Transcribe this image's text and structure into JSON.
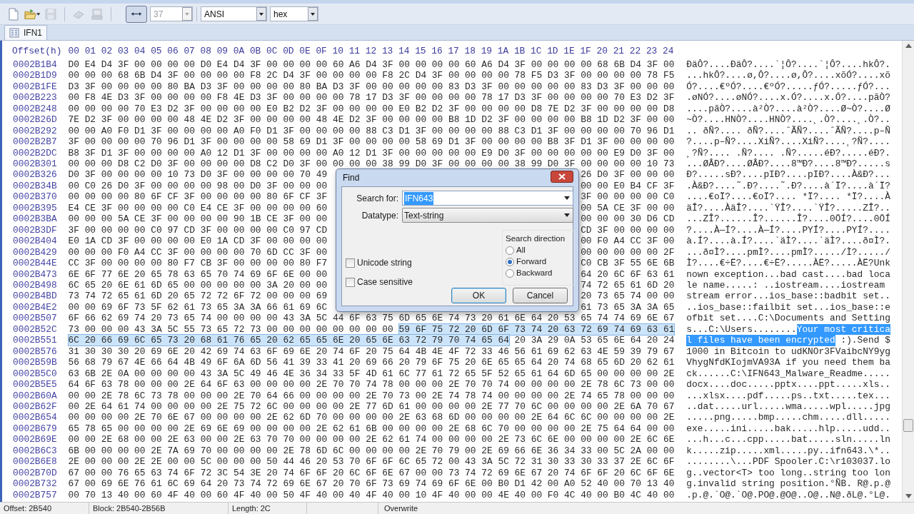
{
  "toolbar": {
    "icon_buttons": [
      {
        "kind": "new",
        "disabled": false
      },
      {
        "kind": "open",
        "disabled": false
      },
      {
        "kind": "save",
        "disabled": true
      },
      {
        "kind": "chip",
        "disabled": true
      },
      {
        "kind": "computer",
        "disabled": true
      },
      {
        "kind": "fit",
        "disabled": false
      }
    ],
    "bytes_per_row": {
      "value": "37",
      "disabled": true
    },
    "charset": {
      "value": "ANSI"
    },
    "view_mode": {
      "value": "hex"
    }
  },
  "tabs": [
    {
      "label": "IFN1",
      "selected": true
    }
  ],
  "editor": {
    "offset_header": "Offset(h)",
    "column_headers": [
      "00",
      "01",
      "02",
      "03",
      "04",
      "05",
      "06",
      "07",
      "08",
      "09",
      "0A",
      "0B",
      "0C",
      "0D",
      "0E",
      "0F",
      "10",
      "11",
      "12",
      "13",
      "14",
      "15",
      "16",
      "17",
      "18",
      "19",
      "1A",
      "1B",
      "1C",
      "1D",
      "1E",
      "1F",
      "20",
      "21",
      "22",
      "23",
      "24"
    ],
    "rows": [
      {
        "offset": "0002B1B4",
        "hex": [
          {
            "bytes": "D0 E4 D4 3F 00 00 00 00 D0 E4 D4 3F 00 00 00 00 60 A6 D4 3F 00 00 00 00 60 A6 D4 3F 00 00 00 00 68 6B D4 3F 00",
            "selected": false
          }
        ],
        "text": [
          {
            "chars": "ÐäÔ?....ÐäÔ?....`¦Ô?....`¦Ô?....hkÔ?.",
            "selected": false
          }
        ]
      },
      {
        "offset": "0002B1D9",
        "hex": [
          {
            "bytes": "00 00 00 68 6B D4 3F 00 00 00 00 F8 2C D4 3F 00 00 00 00 F8 2C D4 3F 00 00 00 00 78 F5 D3 3F 00 00 00 00 78 F5",
            "selected": false
          }
        ],
        "text": [
          {
            "chars": "...hkÔ?....ø,Ô?....ø,Ô?....xõÓ?....xõ",
            "selected": false
          }
        ]
      },
      {
        "offset": "0002B1FE",
        "hex": [
          {
            "bytes": "D3 3F 00 00 00 00 80 BA D3 3F 00 00 00 00 80 BA D3 3F 00 00 00 00 00 83 D3 3F 00 00 00 00 00 83 D3 3F 00 00 00",
            "selected": false
          }
        ],
        "text": [
          {
            "chars": "Ó?....€ºÓ?....€ºÓ?.....ƒÓ?.....ƒÓ?...",
            "selected": false
          }
        ]
      },
      {
        "offset": "0002B223",
        "hex": [
          {
            "bytes": "00 F8 4E D3 3F 00 00 00 00 F8 4E D3 3F 00 00 00 00 78 17 D3 3F 00 00 00 00 78 17 D3 3F 00 00 00 00 70 E3 D2 3F",
            "selected": false
          }
        ],
        "text": [
          {
            "chars": ".øNÓ?....øNÓ?....x.Ó?....x.Ó?....pãÒ?",
            "selected": false
          }
        ]
      },
      {
        "offset": "0002B248",
        "hex": [
          {
            "bytes": "00 00 00 00 70 E3 D2 3F 00 00 00 00 E0 B2 D2 3F 00 00 00 00 E0 B2 D2 3F 00 00 00 00 D8 7E D2 3F 00 00 00 00 D8",
            "selected": false
          }
        ],
        "text": [
          {
            "chars": "....pãÒ?....à²Ò?....à²Ò?....Ø~Ò?....Ø",
            "selected": false
          }
        ]
      },
      {
        "offset": "0002B26D",
        "hex": [
          {
            "bytes": "7E D2 3F 00 00 00 00 48 4E D2 3F 00 00 00 00 48 4E D2 3F 00 00 00 00 B8 1D D2 3F 00 00 00 00 B8 1D D2 3F 00 00",
            "selected": false
          }
        ],
        "text": [
          {
            "chars": "~Ò?....HNÒ?....HNÒ?....¸.Ò?....¸.Ò?..",
            "selected": false
          }
        ]
      },
      {
        "offset": "0002B292",
        "hex": [
          {
            "bytes": "00 00 A0 F0 D1 3F 00 00 00 00 A0 F0 D1 3F 00 00 00 00 88 C3 D1 3F 00 00 00 00 88 C3 D1 3F 00 00 00 00 70 96 D1",
            "selected": false
          }
        ],
        "text": [
          {
            "chars": ".. ðÑ?.... ðÑ?....ˆÃÑ?....ˆÃÑ?....p–Ñ",
            "selected": false
          }
        ]
      },
      {
        "offset": "0002B2B7",
        "hex": [
          {
            "bytes": "3F 00 00 00 00 70 96 D1 3F 00 00 00 00 58 69 D1 3F 00 00 00 00 58 69 D1 3F 00 00 00 00 B8 3F D1 3F 00 00 00 00",
            "selected": false
          }
        ],
        "text": [
          {
            "chars": "?....p–Ñ?....XiÑ?....XiÑ?....¸?Ñ?....",
            "selected": false
          }
        ]
      },
      {
        "offset": "0002B2DC",
        "hex": [
          {
            "bytes": "B8 3F D1 3F 00 00 00 00 A0 12 D1 3F 00 00 00 00 A0 12 D1 3F 00 00 00 00 00 E9 D0 3F 00 00 00 00 00 E9 D0 3F 00",
            "selected": false
          }
        ],
        "text": [
          {
            "chars": "¸?Ñ?.... .Ñ?.... .Ñ?.....éÐ?.....éÐ?.",
            "selected": false
          }
        ]
      },
      {
        "offset": "0002B301",
        "hex": [
          {
            "bytes": "00 00 00 D8 C2 D0 3F 00 00 00 00 D8 C2 D0 3F 00 00 00 00 38 99 D0 3F 00 00 00 00 38 99 D0 3F 00 00 00 00 10 73",
            "selected": false
          }
        ],
        "text": [
          {
            "chars": "...ØÂÐ?....ØÂÐ?....8™Ð?....8™Ð?.....s",
            "selected": false
          }
        ]
      },
      {
        "offset": "0002B326",
        "hex": [
          {
            "bytes": "D0 3F 00 00 00 00 10 73 D0 3F 00 00 00 00 70 49",
            "selected": false
          }
        ],
        "hex_after_dialog": "26 D0 3F 00 00 00",
        "text": [
          {
            "chars": "Ð?.....sÐ?....pIÐ?....pIÐ?....À&Ð?...",
            "selected": false
          }
        ]
      },
      {
        "offset": "0002B34B",
        "hex": [
          {
            "bytes": "00 C0 26 D0 3F 00 00 00 00 98 00 D0 3F 00 00 00",
            "selected": false
          }
        ],
        "hex_after_dialog": "00 00 E0 B4 CF 3F",
        "text": [
          {
            "chars": ".À&Ð?....˜.Ð?....˜.Ð?....à´Ï?....à´Ï?",
            "selected": false
          }
        ]
      },
      {
        "offset": "0002B370",
        "hex": [
          {
            "bytes": "00 00 00 00 80 6F CF 3F 00 00 00 00 80 6F CF 3F",
            "selected": false
          }
        ],
        "hex_after_dialog": "3F 00 00 00 00 C0",
        "text": [
          {
            "chars": "....€oÏ?....€oÏ?.... *Ï?.... *Ï?....À",
            "selected": false
          }
        ]
      },
      {
        "offset": "0002B395",
        "hex": [
          {
            "bytes": "E4 CE 3F 00 00 00 00 C0 E4 CE 3F 00 00 00 00 60",
            "selected": false
          }
        ],
        "hex_after_dialog": "00 5A CE 3F 00 00",
        "text": [
          {
            "chars": "äÎ?....ÀäÎ?....`ŸÎ?....`ŸÎ?.....ZÎ?..",
            "selected": false
          }
        ]
      },
      {
        "offset": "0002B3BA",
        "hex": [
          {
            "bytes": "00 00 00 5A CE 3F 00 00 00 00 90 1B CE 3F 00 00",
            "selected": false
          }
        ],
        "hex_after_dialog": "00 00 00 30 D6 CD",
        "text": [
          {
            "chars": "...ZÎ?......Î?......Î?....0ÖÍ?....0ÖÍ",
            "selected": false
          }
        ]
      },
      {
        "offset": "0002B3DF",
        "hex": [
          {
            "bytes": "3F 00 00 00 00 C0 97 CD 3F 00 00 00 00 C0 97 CD",
            "selected": false
          }
        ],
        "hex_after_dialog": "CD 3F 00 00 00 00",
        "text": [
          {
            "chars": "?....À—Í?....À—Í?....PYÍ?....PYÍ?....",
            "selected": false
          }
        ]
      },
      {
        "offset": "0002B404",
        "hex": [
          {
            "bytes": "E0 1A CD 3F 00 00 00 00 E0 1A CD 3F 00 00 00 00",
            "selected": false
          }
        ],
        "hex_after_dialog": "00 F0 A4 CC 3F 00",
        "text": [
          {
            "chars": "à.Í?....à.Í?....`äÌ?....`äÌ?....ð¤Ì?.",
            "selected": false
          }
        ]
      },
      {
        "offset": "0002B429",
        "hex": [
          {
            "bytes": "00 00 00 F0 A4 CC 3F 00 00 00 00 70 6D CC 3F 00",
            "selected": false
          }
        ],
        "hex_after_dialog": "00 00 00 00 00 2F",
        "text": [
          {
            "chars": "...ð¤Ì?....pmÌ?....pmÌ?...../Ì?...../",
            "selected": false
          }
        ]
      },
      {
        "offset": "0002B44E",
        "hex": [
          {
            "bytes": "CC 3F 00 00 00 00 80 F7 CB 3F 00 00 00 00 80 F7",
            "selected": false
          }
        ],
        "hex_after_dialog": "C0 CB 3F 55 6E 6B",
        "text": [
          {
            "chars": "Ì?....€÷Ë?....€÷Ë?.....ÀË?.....ÀË?Unk",
            "selected": false
          }
        ]
      },
      {
        "offset": "0002B473",
        "hex": [
          {
            "bytes": "6E 6F 77 6E 20 65 78 63 65 70 74 69 6F 6E 00 00",
            "selected": false
          }
        ],
        "hex_after_dialog": "64 20 6C 6F 63 61",
        "text": [
          {
            "chars": "nown exception...bad cast....bad loca",
            "selected": false
          }
        ]
      },
      {
        "offset": "0002B498",
        "hex": [
          {
            "bytes": "6C 65 20 6E 61 6D 65 00 00 00 00 00 3A 20 00 00",
            "selected": false
          }
        ],
        "hex_after_dialog": "74 72 65 61 6D 20",
        "text": [
          {
            "chars": "le name.....: ..iostream....iostream ",
            "selected": false
          }
        ]
      },
      {
        "offset": "0002B4BD",
        "hex": [
          {
            "bytes": "73 74 72 65 61 6D 20 65 72 72 6F 72 00 00 00 69",
            "selected": false
          }
        ],
        "hex_after_dialog": "20 73 65 74 00 00",
        "text": [
          {
            "chars": "stream error...ios_base::badbit set..",
            "selected": false
          }
        ]
      },
      {
        "offset": "0002B4E2",
        "hex": [
          {
            "bytes": "00 00 69 6F 73 5F 62 61 73 65 3A 3A 66 61 69 6C",
            "selected": false
          }
        ],
        "hex_after_dialog": "61 73 65 3A 3A 65",
        "text": [
          {
            "chars": "..ios_base::failbit set...ios_base::e",
            "selected": false
          }
        ]
      },
      {
        "offset": "0002B507",
        "hex": [
          {
            "bytes": "6F 66 62 69 74 20 73 65 74 00 00 00 00 43 3A 5C 44 6F 63 75 6D 65 6E 74 73 20 61 6E 64 20 53 65 74 74 69 6E 67",
            "selected": false
          }
        ],
        "text": [
          {
            "chars": "ofbit set....C:\\Documents and Setting",
            "selected": false
          }
        ]
      },
      {
        "offset": "0002B52C",
        "hex": [
          {
            "bytes": "73 00 00 00 43 3A 5C 55 73 65 72 73 00 00 00 00 00 00 00 00",
            "selected": false
          },
          {
            "bytes": "59 6F 75 72 20 6D 6F 73 74 20 63 72 69 74 69 63 61",
            "selected": true
          }
        ],
        "text": [
          {
            "chars": "s...C:\\Users........",
            "selected": false
          },
          {
            "chars": "Your most critica",
            "selected": true
          }
        ]
      },
      {
        "offset": "0002B551",
        "hex": [
          {
            "bytes": "6C 20 66 69 6C 65 73 20 68 61 76 65 20 62 65 65 6E 20 65 6E 63 72 79 70 74 65 64",
            "selected": true
          },
          {
            "bytes": "20 3A 29 0A 53 65 6E 64 20 24",
            "selected": false
          }
        ],
        "text": [
          {
            "chars": "l files have been encrypted",
            "selected": true
          },
          {
            "chars": " :).Send $",
            "selected": false
          }
        ]
      },
      {
        "offset": "0002B576",
        "hex": [
          {
            "bytes": "31 30 30 30 20 69 6E 20 42 69 74 63 6F 69 6E 20 74 6F 20 75 64 4B 4E 4F 72 33 46 56 61 69 62 63 4E 59 39 79 67",
            "selected": false
          }
        ],
        "text": [
          {
            "chars": "1000 in Bitcoin to udKNOr3FVaibcNY9yg",
            "selected": false
          }
        ]
      },
      {
        "offset": "0002B59B",
        "hex": [
          {
            "bytes": "56 68 79 67 4E 66 64 4B 49 6F 6A 6D 56 41 39 33 41 20 69 66 20 79 6F 75 20 6E 65 65 64 20 74 68 65 6D 20 62 61",
            "selected": false
          }
        ],
        "text": [
          {
            "chars": "VhygNfdKIojmVA93A if you need them ba",
            "selected": false
          }
        ]
      },
      {
        "offset": "0002B5C0",
        "hex": [
          {
            "bytes": "63 6B 2E 0A 00 00 00 00 43 3A 5C 49 46 4E 36 34 33 5F 4D 61 6C 77 61 72 65 5F 52 65 61 64 6D 65 00 00 00 00 2E",
            "selected": false
          }
        ],
        "text": [
          {
            "chars": "ck......C:\\IFN643_Malware_Readme.....",
            "selected": false
          }
        ]
      },
      {
        "offset": "0002B5E5",
        "hex": [
          {
            "bytes": "64 6F 63 78 00 00 00 2E 64 6F 63 00 00 00 00 2E 70 70 74 78 00 00 00 2E 70 70 74 00 00 00 00 2E 78 6C 73 00 00",
            "selected": false
          }
        ],
        "text": [
          {
            "chars": "docx....doc.....pptx....ppt.....xls..",
            "selected": false
          }
        ]
      },
      {
        "offset": "0002B60A",
        "hex": [
          {
            "bytes": "00 00 2E 78 6C 73 78 00 00 00 2E 70 64 66 00 00 00 00 2E 70 73 00 2E 74 78 74 00 00 00 00 2E 74 65 78 00 00 00",
            "selected": false
          }
        ],
        "text": [
          {
            "chars": "...xlsx....pdf.....ps..txt.....tex...",
            "selected": false
          }
        ]
      },
      {
        "offset": "0002B62F",
        "hex": [
          {
            "bytes": "00 2E 64 61 74 00 00 00 00 2E 75 72 6C 00 00 00 00 2E 77 6D 61 00 00 00 00 2E 77 70 6C 00 00 00 00 2E 6A 70 67",
            "selected": false
          }
        ],
        "text": [
          {
            "chars": "..dat.....url.....wma.....wpl.....jpg",
            "selected": false
          }
        ]
      },
      {
        "offset": "0002B654",
        "hex": [
          {
            "bytes": "00 00 00 00 2E 70 6E 67 00 00 00 00 2E 62 6D 70 00 00 00 00 2E 63 68 6D 00 00 00 00 2E 64 6C 6C 00 00 00 00 2E",
            "selected": false
          }
        ],
        "text": [
          {
            "chars": ".....png.....bmp.....chm.....dll.....",
            "selected": false
          }
        ]
      },
      {
        "offset": "0002B679",
        "hex": [
          {
            "bytes": "65 78 65 00 00 00 00 2E 69 6E 69 00 00 00 00 2E 62 61 6B 00 00 00 00 2E 68 6C 70 00 00 00 00 2E 75 64 64 00 00",
            "selected": false
          }
        ],
        "text": [
          {
            "chars": "exe.....ini.....bak.....hlp.....udd..",
            "selected": false
          }
        ]
      },
      {
        "offset": "0002B69E",
        "hex": [
          {
            "bytes": "00 00 2E 68 00 00 2E 63 00 00 2E 63 70 70 00 00 00 00 2E 62 61 74 00 00 00 00 2E 73 6C 6E 00 00 00 00 2E 6C 6E",
            "selected": false
          }
        ],
        "text": [
          {
            "chars": "...h...c...cpp.....bat.....sln.....ln",
            "selected": false
          }
        ]
      },
      {
        "offset": "0002B6C3",
        "hex": [
          {
            "bytes": "6B 00 00 00 00 2E 7A 69 70 00 00 00 00 2E 78 6D 6C 00 00 00 00 2E 70 79 00 2E 69 66 6E 36 34 33 00 5C 2A 00 00",
            "selected": false
          }
        ],
        "text": [
          {
            "chars": "k.....zip.....xml.....py..ifn643.\\*..",
            "selected": false
          }
        ]
      },
      {
        "offset": "0002B6E8",
        "hex": [
          {
            "bytes": "2E 00 00 00 2E 2E 00 00 5C 00 00 00 50 44 46 20 53 70 6F 6F 6C 65 72 00 43 3A 5C 72 31 30 33 30 33 37 2E 6C 6F",
            "selected": false
          }
        ],
        "text": [
          {
            "chars": "........\\...PDF Spooler.C:\\r103037.lo",
            "selected": false
          }
        ]
      },
      {
        "offset": "0002B70D",
        "hex": [
          {
            "bytes": "67 00 00 76 65 63 74 6F 72 3C 54 3E 20 74 6F 6F 20 6C 6F 6E 67 00 00 73 74 72 69 6E 67 20 74 6F 6F 20 6C 6F 6E",
            "selected": false
          }
        ],
        "text": [
          {
            "chars": "g..vector<T> too long..string too lon",
            "selected": false
          }
        ]
      },
      {
        "offset": "0002B732",
        "hex": [
          {
            "bytes": "67 00 69 6E 76 61 6C 69 64 20 73 74 72 69 6E 67 20 70 6F 73 69 74 69 6F 6E 00 B0 D1 42 00 A0 52 40 00 70 13 40",
            "selected": false
          }
        ],
        "text": [
          {
            "chars": "g.invalid string position.°ÑB. R@.p.@",
            "selected": false
          }
        ]
      },
      {
        "offset": "0002B757",
        "hex": [
          {
            "bytes": "00 70 13 40 00 60 4F 40 00 60 4F 40 00 50 4F 40 00 40 4F 40 00 10 4F 40 00 00 4E 40 00 F0 4C 40 00 B0 4C 40 00",
            "selected": false
          }
        ],
        "text": [
          {
            "chars": ".p.@.`O@.`O@.PO@.@O@..O@..N@.ðL@.°L@.",
            "selected": false
          }
        ]
      }
    ]
  },
  "find_dialog": {
    "title": "Find",
    "search_for": {
      "label": "Search for:",
      "value": "IFN643",
      "value_selected": true
    },
    "datatype": {
      "label": "Datatype:",
      "value": "Text-string"
    },
    "options": [
      {
        "label": "Unicode string",
        "checked": false
      },
      {
        "label": "Case sensitive",
        "checked": false
      }
    ],
    "direction": {
      "label": "Search direction",
      "choices": [
        {
          "label": "All",
          "selected": false
        },
        {
          "label": "Forward",
          "selected": true
        },
        {
          "label": "Backward",
          "selected": false
        }
      ]
    },
    "buttons": [
      {
        "label": "OK",
        "default": true
      },
      {
        "label": "Cancel",
        "default": false
      }
    ]
  },
  "status_bar": [
    "Offset: 2B540",
    "Block: 2B540-2B56B",
    "Length: 2C",
    "Overwrite"
  ]
}
